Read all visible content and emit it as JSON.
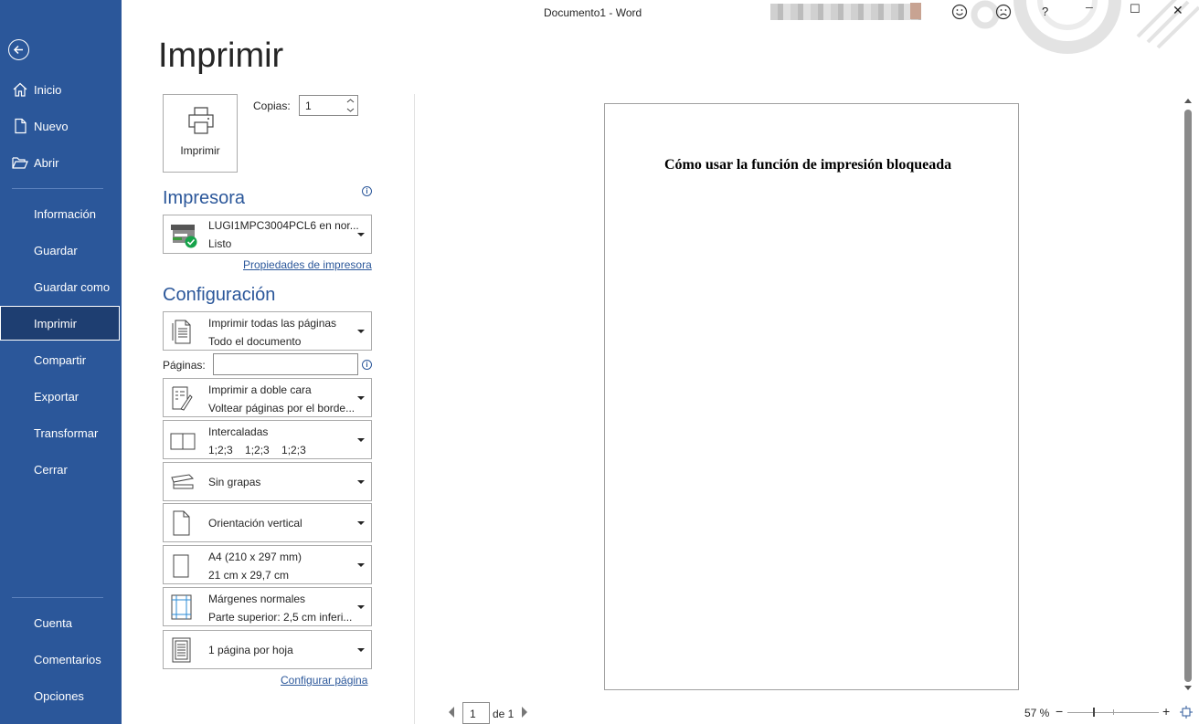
{
  "window": {
    "title": "Documento1  -  Word",
    "minimize_label": "─",
    "maximize_label": "☐",
    "close_label": "✕",
    "help_label": "?"
  },
  "colors": {
    "sidebar_bg": "#2b579a",
    "active_bg": "#1e3e71",
    "accent": "#2b579a"
  },
  "sidebar": {
    "items": [
      {
        "label": "Inicio",
        "icon": "home-icon"
      },
      {
        "label": "Nuevo",
        "icon": "new-document-icon"
      },
      {
        "label": "Abrir",
        "icon": "folder-open-icon"
      },
      {
        "label": "Información"
      },
      {
        "label": "Guardar"
      },
      {
        "label": "Guardar como"
      },
      {
        "label": "Imprimir",
        "active": true
      },
      {
        "label": "Compartir"
      },
      {
        "label": "Exportar"
      },
      {
        "label": "Transformar"
      },
      {
        "label": "Cerrar"
      },
      {
        "label": "Cuenta"
      },
      {
        "label": "Comentarios"
      },
      {
        "label": "Opciones"
      }
    ]
  },
  "print": {
    "title": "Imprimir",
    "button_label": "Imprimir",
    "copies_label": "Copias:",
    "copies_value": "1"
  },
  "printer": {
    "section_title": "Impresora",
    "name": "LUGI1MPC3004PCL6 en nor...",
    "status": "Listo",
    "properties_link": "Propiedades de impresora"
  },
  "settings": {
    "section_title": "Configuración",
    "pages_label": "Páginas:",
    "pages_value": "",
    "options": [
      {
        "line1": "Imprimir todas las páginas",
        "line2": "Todo el documento",
        "icon": "pages-icon"
      },
      {
        "line1": "Imprimir a doble cara",
        "line2": "Voltear páginas por el borde...",
        "icon": "duplex-icon"
      },
      {
        "line1": "Intercaladas",
        "line2": "1;2;3    1;2;3    1;2;3",
        "icon": "collate-icon"
      },
      {
        "line1": "Sin grapas",
        "line2": "",
        "icon": "stapler-icon"
      },
      {
        "line1": "Orientación vertical",
        "line2": "",
        "icon": "portrait-icon"
      },
      {
        "line1": "A4 (210 x 297 mm)",
        "line2": "21 cm x 29,7 cm",
        "icon": "paper-size-icon"
      },
      {
        "line1": "Márgenes normales",
        "line2": "Parte superior: 2,5 cm inferi...",
        "icon": "margins-icon"
      },
      {
        "line1": "1 página por hoja",
        "line2": "",
        "icon": "pages-per-sheet-icon"
      }
    ],
    "page_setup_link": "Configurar página"
  },
  "preview": {
    "heading": "Cómo usar la función de impresión bloqueada",
    "current_page": "1",
    "of_pages": "de 1",
    "zoom": "57 %",
    "zoom_out_label": "−",
    "zoom_in_label": "+",
    "zoom_fraction": 0.57
  }
}
